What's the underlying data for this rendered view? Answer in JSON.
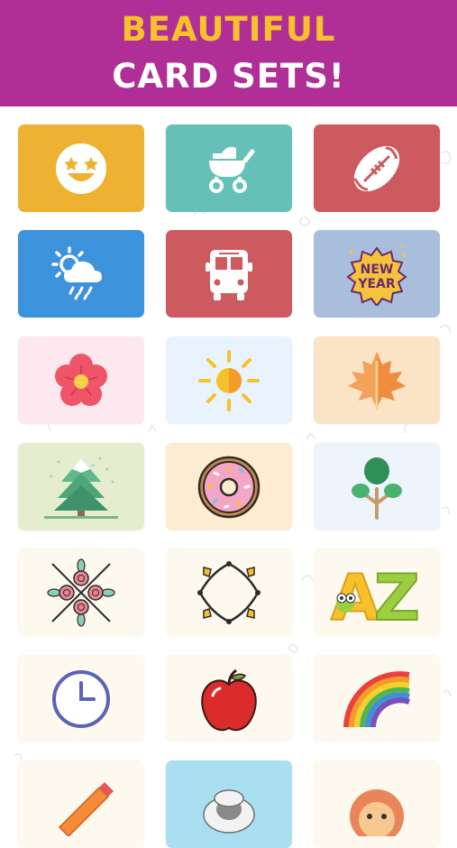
{
  "header": {
    "line1": "BEAUTIFUL",
    "line2": "CARD SETS!",
    "line1_color": "#f6c12c",
    "line2_color": "#ffffff",
    "background": "#b02f96"
  },
  "cards": [
    {
      "id": "emoji",
      "icon": "star-eyes-smiley-icon",
      "bg": "#eeb132"
    },
    {
      "id": "baby",
      "icon": "baby-stroller-icon",
      "bg": "#65c1b7"
    },
    {
      "id": "sports",
      "icon": "football-icon",
      "bg": "#cd5a5e"
    },
    {
      "id": "weather",
      "icon": "sun-cloud-rain-icon",
      "bg": "#3c93db"
    },
    {
      "id": "transport",
      "icon": "bus-icon",
      "bg": "#cd5a5e"
    },
    {
      "id": "holiday",
      "icon": "new-year-badge-icon",
      "bg": "#a9bddd",
      "text": "NEW YEAR"
    },
    {
      "id": "spring",
      "icon": "flower-icon",
      "bg": "#fde8ef"
    },
    {
      "id": "summer",
      "icon": "sun-icon",
      "bg": "#e9f3fd"
    },
    {
      "id": "autumn",
      "icon": "maple-leaf-icon",
      "bg": "#fbe3c6"
    },
    {
      "id": "winter",
      "icon": "snowy-tree-icon",
      "bg": "#e4eecf"
    },
    {
      "id": "food",
      "icon": "donut-icon",
      "bg": "#fdebd2"
    },
    {
      "id": "nature",
      "icon": "tree-icon",
      "bg": "#edf4fc"
    },
    {
      "id": "pattern-roses",
      "icon": "rose-ornament-icon",
      "bg": "#fdf9ef"
    },
    {
      "id": "pattern-leaves",
      "icon": "leaf-frame-icon",
      "bg": "#fdf9ef"
    },
    {
      "id": "alphabet",
      "icon": "az-letters-icon",
      "bg": "#fdf9ef",
      "text": "AZ"
    },
    {
      "id": "time",
      "icon": "clock-icon",
      "bg": "#fdf9ef"
    },
    {
      "id": "fruit",
      "icon": "apple-icon",
      "bg": "#fdf9ef"
    },
    {
      "id": "colors",
      "icon": "rainbow-icon",
      "bg": "#fdf9ef"
    },
    {
      "id": "school",
      "icon": "pencil-icon",
      "bg": "#fdf9ef"
    },
    {
      "id": "animals",
      "icon": "sheep-icon",
      "bg": "#a9dff1"
    },
    {
      "id": "wild-animals",
      "icon": "lion-icon",
      "bg": "#fdf9ef"
    }
  ]
}
